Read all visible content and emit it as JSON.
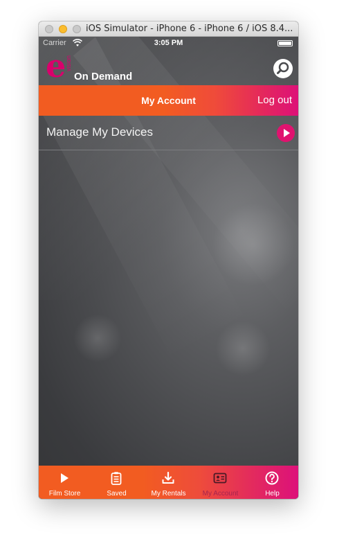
{
  "window": {
    "title": "iOS Simulator - iPhone 6 - iPhone 6 / iOS 8.4..."
  },
  "status_bar": {
    "carrier": "Carrier",
    "time": "3:05 PM"
  },
  "app_header": {
    "logo_letter": "e",
    "logo_small_text": "vision",
    "logo_text": "On Demand",
    "search_icon": "search-icon"
  },
  "account_bar": {
    "title": "My Account",
    "logout_label": "Log out"
  },
  "menu": {
    "items": [
      {
        "label": "Manage My Devices",
        "icon": "play-arrow-icon"
      }
    ]
  },
  "tab_bar": {
    "active_tab": "My Account",
    "tabs": [
      {
        "label": "Film Store",
        "icon": "play-icon"
      },
      {
        "label": "Saved",
        "icon": "clipboard-list-icon"
      },
      {
        "label": "My Rentals",
        "icon": "download-icon"
      },
      {
        "label": "My Account",
        "icon": "id-card-icon"
      },
      {
        "label": "Help",
        "icon": "help-circle-icon"
      }
    ]
  },
  "colors": {
    "brand_orange": "#f25c21",
    "brand_magenta": "#dd1178",
    "active_tab_text": "#a6254e",
    "background": "#4a4b4e"
  }
}
